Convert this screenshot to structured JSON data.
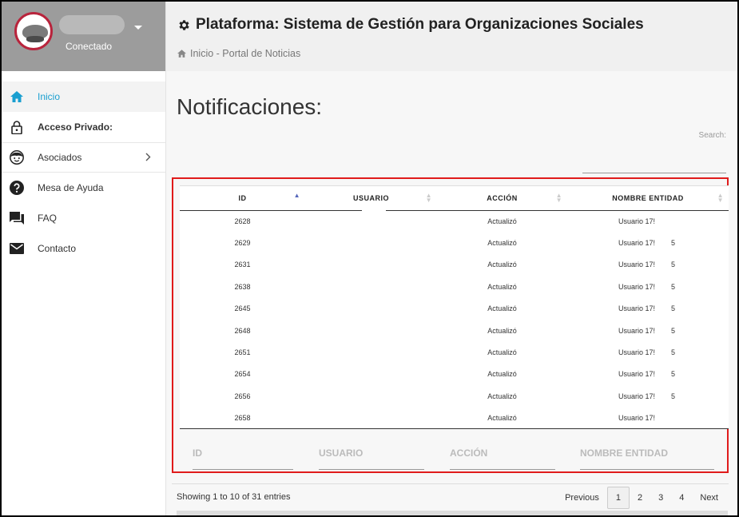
{
  "profile": {
    "status": "Conectado"
  },
  "sidebar": {
    "items": [
      {
        "label": "Inicio",
        "icon": "home-icon"
      },
      {
        "label": "Acceso Privado:",
        "icon": "lock-icon"
      },
      {
        "label": "Asociados",
        "icon": "face-icon"
      },
      {
        "label": "Mesa de Ayuda",
        "icon": "help-icon"
      },
      {
        "label": "FAQ",
        "icon": "chat-icon"
      },
      {
        "label": "Contacto",
        "icon": "mail-icon"
      }
    ]
  },
  "header": {
    "title": "Plataforma: Sistema de Gestión para Organizaciones Sociales",
    "breadcrumb": "Inicio - Portal de Noticias"
  },
  "main": {
    "section_title": "Notificaciones:",
    "search_label": "Search:",
    "search_value": ""
  },
  "table": {
    "columns": [
      "ID",
      "USUARIO",
      "ACCIÓN",
      "NOMBRE ENTIDAD"
    ],
    "rows": [
      {
        "id": "2628",
        "usuario": "",
        "accion": "Actualizó",
        "entidad": "Usuario 17!",
        "suffix": ""
      },
      {
        "id": "2629",
        "usuario": "",
        "accion": "Actualizó",
        "entidad": "Usuario 17!",
        "suffix": "5"
      },
      {
        "id": "2631",
        "usuario": "",
        "accion": "Actualizó",
        "entidad": "Usuario 17!",
        "suffix": "5"
      },
      {
        "id": "2638",
        "usuario": "",
        "accion": "Actualizó",
        "entidad": "Usuario 17!",
        "suffix": "5"
      },
      {
        "id": "2645",
        "usuario": "",
        "accion": "Actualizó",
        "entidad": "Usuario 17!",
        "suffix": "5"
      },
      {
        "id": "2648",
        "usuario": "",
        "accion": "Actualizó",
        "entidad": "Usuario 17!",
        "suffix": "5"
      },
      {
        "id": "2651",
        "usuario": "",
        "accion": "Actualizó",
        "entidad": "Usuario 17!",
        "suffix": "5"
      },
      {
        "id": "2654",
        "usuario": "",
        "accion": "Actualizó",
        "entidad": "Usuario 17!",
        "suffix": "5"
      },
      {
        "id": "2656",
        "usuario": "",
        "accion": "Actualizó",
        "entidad": "Usuario 17!",
        "suffix": "5"
      },
      {
        "id": "2658",
        "usuario": "",
        "accion": "Actualizó",
        "entidad": "Usuario 17!",
        "suffix": ""
      }
    ],
    "filters": [
      "ID",
      "USUARIO",
      "ACCIÓN",
      "NOMBRE ENTIDAD"
    ]
  },
  "footer": {
    "info": "Showing 1 to 10 of 31 entries",
    "previous": "Previous",
    "pages": [
      "1",
      "2",
      "3",
      "4"
    ],
    "next": "Next"
  },
  "colors": {
    "accent": "#1a9fd0",
    "highlight": "#e01b1b",
    "sort_active": "#5566bb"
  }
}
